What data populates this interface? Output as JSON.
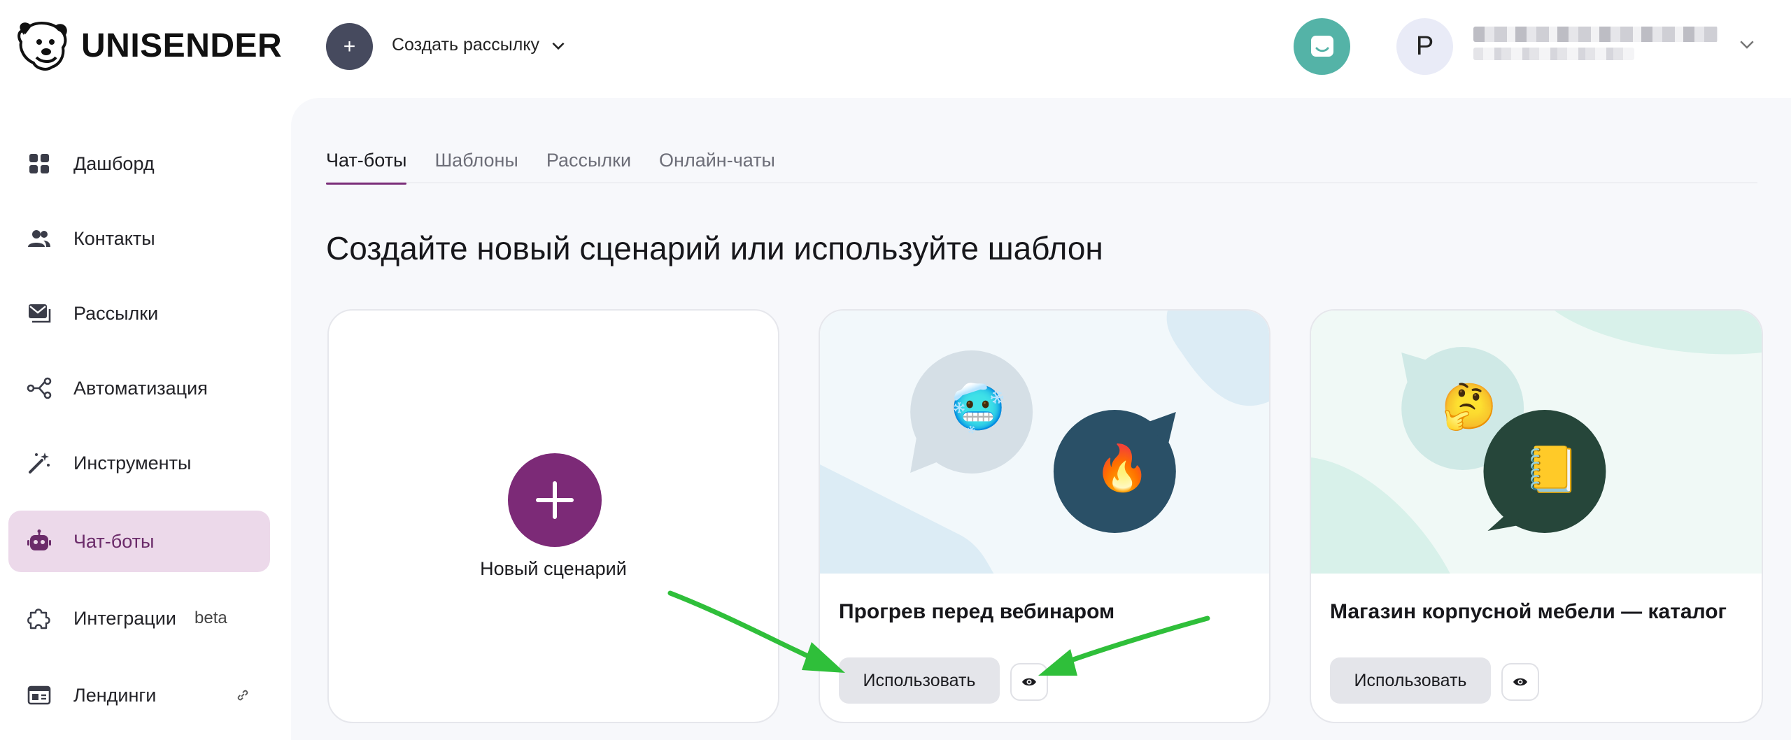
{
  "brand": {
    "name": "UNISENDER"
  },
  "header": {
    "create_button_symbol": "+",
    "create_label": "Создать рассылку",
    "avatar_letter": "Р"
  },
  "sidebar": {
    "items": [
      {
        "label": "Дашборд",
        "icon": "dashboard-icon"
      },
      {
        "label": "Контакты",
        "icon": "contacts-icon"
      },
      {
        "label": "Рассылки",
        "icon": "mailings-icon"
      },
      {
        "label": "Автоматизация",
        "icon": "automation-icon"
      },
      {
        "label": "Инструменты",
        "icon": "magic-wand-icon"
      },
      {
        "label": "Чат-боты",
        "icon": "robot-icon",
        "active": true
      },
      {
        "label": "Интеграции",
        "icon": "puzzle-icon",
        "badge": "beta"
      },
      {
        "label": "Лендинги",
        "icon": "landing-icon",
        "link": true
      }
    ]
  },
  "tabs": [
    {
      "label": "Чат-боты",
      "active": true
    },
    {
      "label": "Шаблоны"
    },
    {
      "label": "Рассылки"
    },
    {
      "label": "Онлайн-чаты"
    }
  ],
  "main": {
    "title": "Создайте новый сценарий или используйте шаблон",
    "new_card": {
      "label": "Новый сценарий"
    },
    "templates": [
      {
        "title": "Прогрев перед вебинаром",
        "use_label": "Использовать",
        "emoji": [
          "🥶",
          "🔥"
        ]
      },
      {
        "title": "Магазин корпусной мебели — каталог",
        "use_label": "Использовать",
        "emoji": [
          "🤔",
          "📒"
        ]
      }
    ]
  },
  "colors": {
    "accent": "#7c2a77",
    "active_nav_bg": "#ecd9ea",
    "support_teal": "#54b3a7",
    "annotation_arrow": "#2fbf3a"
  }
}
